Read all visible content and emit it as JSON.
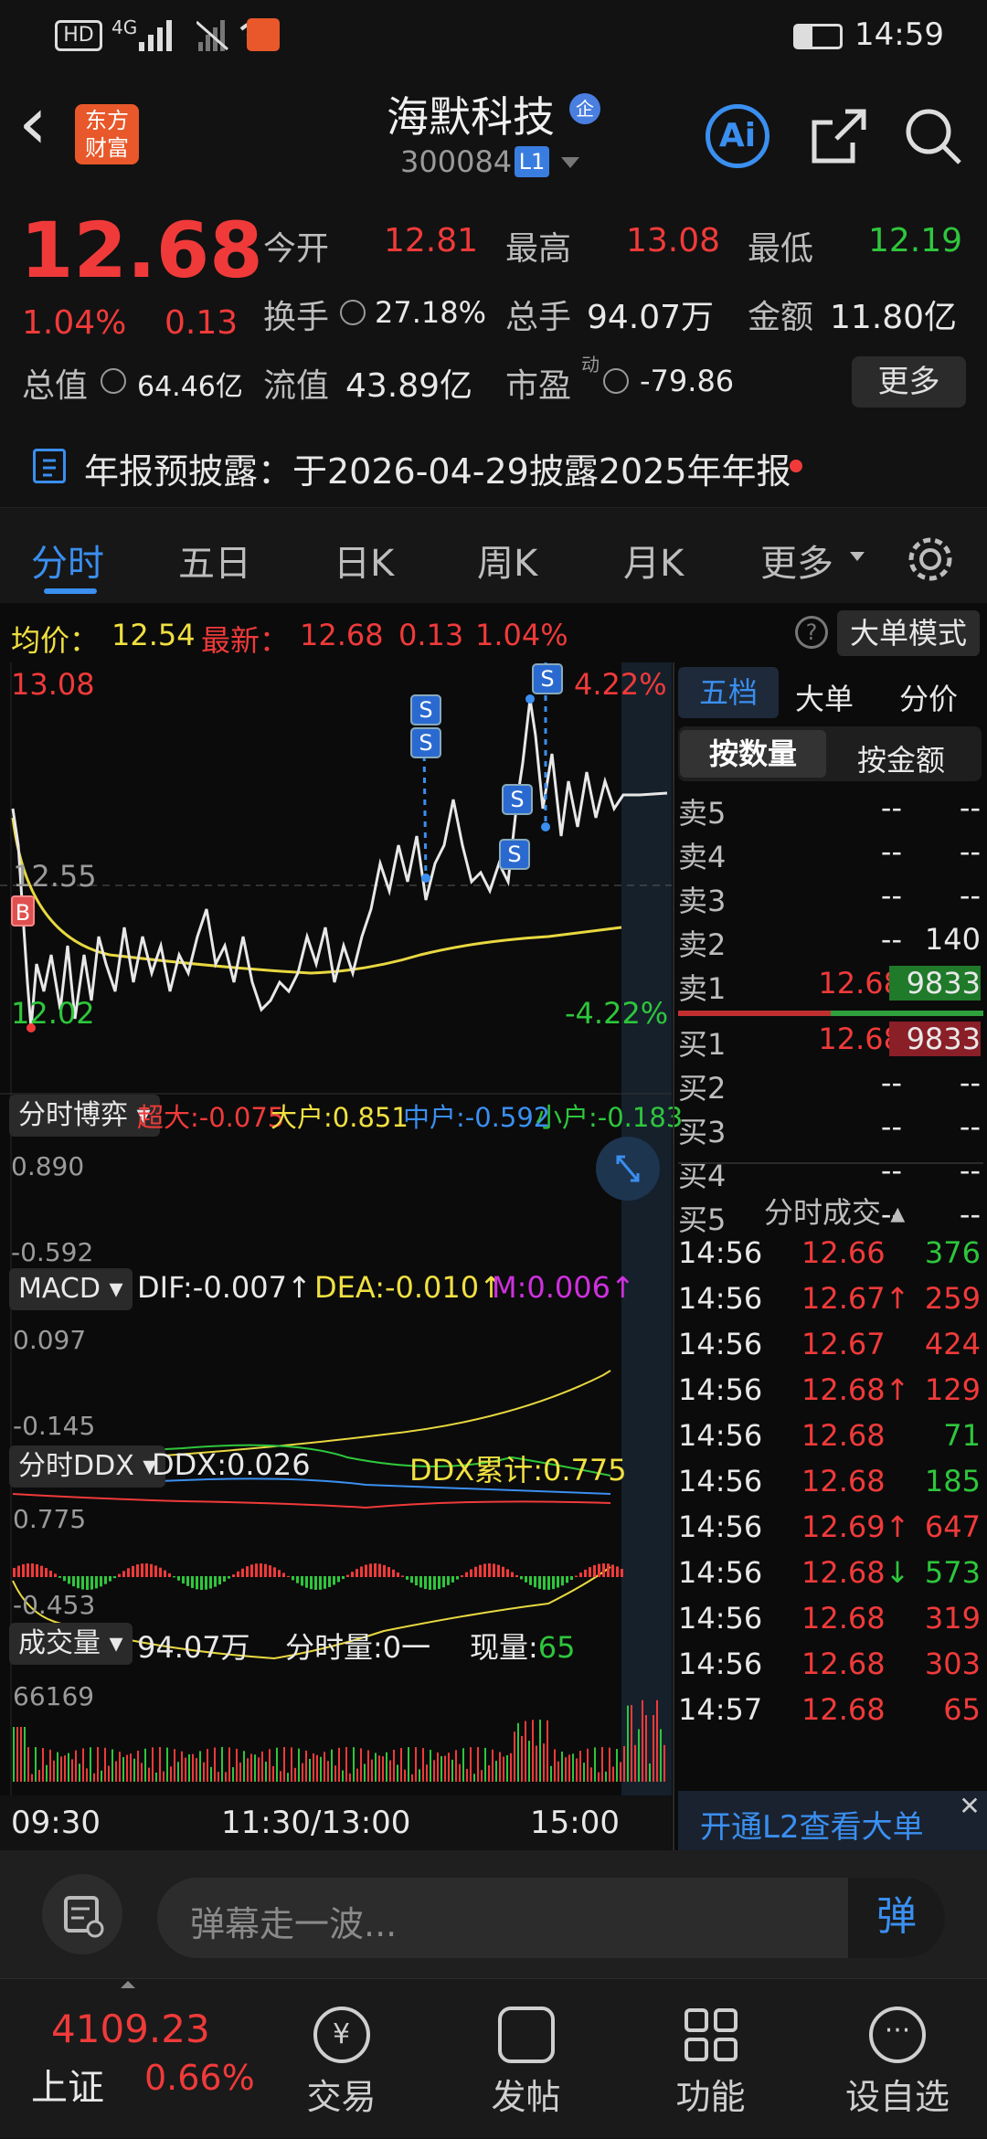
{
  "status": {
    "time": "14:59",
    "net": "4G",
    "hd": "HD"
  },
  "header": {
    "back": "‹",
    "logo_line1": "东方",
    "logo_line2": "财富",
    "title": "海默科技",
    "title_badge": "企",
    "code": "300084",
    "level": "L1",
    "ai": "Ai"
  },
  "quote": {
    "price": "12.68",
    "pct": "1.04%",
    "chg": "0.13",
    "open_label": "今开",
    "open": "12.81",
    "high_label": "最高",
    "high": "13.08",
    "low_label": "最低",
    "low": "12.19",
    "turnover_label": "换手",
    "turnover": "27.18%",
    "volume_label": "总手",
    "volume": "94.07万",
    "amount_label": "金额",
    "amount": "11.80亿",
    "mktcap_label": "总值",
    "mktcap": "64.46亿",
    "float_label": "流值",
    "float": "43.89亿",
    "pe_label": "市盈",
    "pe_sup": "动",
    "pe": "-79.86",
    "more": "更多"
  },
  "notice": {
    "text": "年报预披露：于2026-04-29披露2025年年报"
  },
  "tabs": [
    "分时",
    "五日",
    "日K",
    "周K",
    "月K",
    "更多"
  ],
  "chart": {
    "avg_label": "均价：",
    "avg": "12.54",
    "last_label": "最新：",
    "last": "12.68",
    "last_chg": "0.13",
    "last_pct": "1.04%",
    "bigorder_mode": "大单模式",
    "y_high": "13.08",
    "y_mid": "12.55",
    "y_low": "12.02",
    "pct_high": "4.22%",
    "pct_low": "-4.22%",
    "marker_b": "B",
    "marker_s": "S",
    "game_btn": "分时博弈",
    "chaoda": "超大:-0.075",
    "dahu": "大户:0.851",
    "zhonghu": "中户:-0.592",
    "xiaohu": "小户:-0.183",
    "game_top": "0.890",
    "game_bot": "-0.592",
    "macd_btn": "MACD",
    "dif": "DIF:-0.007",
    "dif_arrow": "↑",
    "dea": "DEA:-0.010",
    "dea_arrow": "↑",
    "m": "M:0.006",
    "m_arrow": "↑",
    "macd_top": "0.097",
    "macd_bot": "-0.145",
    "ddx_btn": "分时DDX",
    "ddx": "DDX:0.026",
    "ddx_sum": "DDX累计:0.775",
    "ddx_top": "0.775",
    "ddx_bot": "-0.453",
    "vol_btn": "成交量",
    "vol_total": "94.07万",
    "vol_min_label": "分时量:",
    "vol_min": "0一",
    "vol_now_label": "现量:",
    "vol_now": "65",
    "vol_top": "66169",
    "t_start": "09:30",
    "t_mid": "11:30/13:00",
    "t_end": "15:00"
  },
  "orderbook": {
    "tab_five": "五档",
    "tab_big": "大单",
    "tab_price": "分价",
    "by_qty": "按数量",
    "by_amt": "按金额",
    "sells": [
      {
        "k": "卖5",
        "p": "--",
        "v": "--"
      },
      {
        "k": "卖4",
        "p": "--",
        "v": "--"
      },
      {
        "k": "卖3",
        "p": "--",
        "v": "--"
      },
      {
        "k": "卖2",
        "p": "--",
        "v": "140"
      },
      {
        "k": "卖1",
        "p": "12.68",
        "v": "9833"
      }
    ],
    "buys": [
      {
        "k": "买1",
        "p": "12.68",
        "v": "9833"
      },
      {
        "k": "买2",
        "p": "--",
        "v": "--"
      },
      {
        "k": "买3",
        "p": "--",
        "v": "--"
      },
      {
        "k": "买4",
        "p": "--",
        "v": "--"
      },
      {
        "k": "买5",
        "p": "--",
        "v": "--"
      }
    ]
  },
  "trades": {
    "title": "分时成交",
    "rows": [
      {
        "t": "14:56",
        "p": "12.66",
        "a": "",
        "v": "376",
        "c": "green"
      },
      {
        "t": "14:56",
        "p": "12.67",
        "a": "↑",
        "v": "259",
        "c": "red"
      },
      {
        "t": "14:56",
        "p": "12.67",
        "a": "",
        "v": "424",
        "c": "red"
      },
      {
        "t": "14:56",
        "p": "12.68",
        "a": "↑",
        "v": "129",
        "c": "red"
      },
      {
        "t": "14:56",
        "p": "12.68",
        "a": "",
        "v": "71",
        "c": "green"
      },
      {
        "t": "14:56",
        "p": "12.68",
        "a": "",
        "v": "185",
        "c": "green"
      },
      {
        "t": "14:56",
        "p": "12.69",
        "a": "↑",
        "v": "647",
        "c": "red"
      },
      {
        "t": "14:56",
        "p": "12.68",
        "a": "↓",
        "v": "573",
        "c": "green"
      },
      {
        "t": "14:56",
        "p": "12.68",
        "a": "",
        "v": "319",
        "c": "red"
      },
      {
        "t": "14:56",
        "p": "12.68",
        "a": "",
        "v": "303",
        "c": "red"
      },
      {
        "t": "14:57",
        "p": "12.68",
        "a": "",
        "v": "65",
        "c": "red"
      }
    ],
    "l2_promo": "开通L2查看大单"
  },
  "bottom": {
    "danmu_placeholder": "弹幕走一波...",
    "danmu_btn": "弹",
    "index_value": "4109.23",
    "index_name": "上证",
    "index_pct": "0.66%",
    "nav": [
      "交易",
      "发帖",
      "功能",
      "设自选"
    ]
  }
}
